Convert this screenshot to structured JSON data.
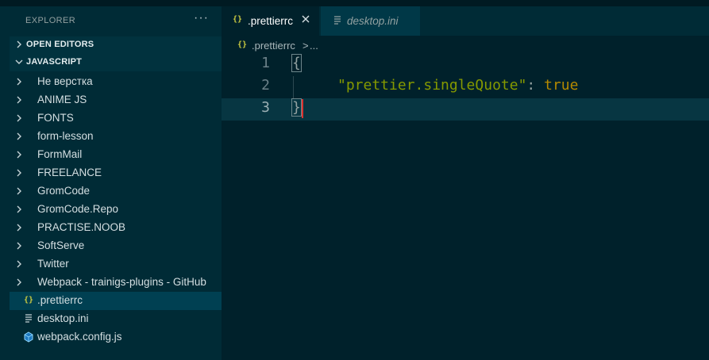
{
  "window": {
    "app": "Visual Studio Code",
    "theme": "Solarized Dark"
  },
  "explorer": {
    "title": "EXPLORER",
    "more_label": "···",
    "sections": {
      "open_editors": "OPEN EDITORS",
      "workspace": "JAVASCRIPT"
    },
    "folders": [
      "Не верстка",
      "ANIME JS",
      "FONTS",
      "form-lesson",
      "FormMail",
      "FREELANCE",
      "GromCode",
      "GromCode.Repo",
      "PRACTISE.NOOB",
      "SoftServe",
      "Twitter",
      "Webpack - trainigs-plugins - GitHub"
    ],
    "files": [
      {
        "name": ".prettierrc",
        "icon": "json-braces-icon",
        "selected": true
      },
      {
        "name": "desktop.ini",
        "icon": "text-lines-icon",
        "selected": false
      },
      {
        "name": "webpack.config.js",
        "icon": "webpack-cube-icon",
        "selected": false
      }
    ]
  },
  "tabs": [
    {
      "label": ".prettierrc",
      "icon": "json-braces-icon",
      "active": true,
      "close_icon": "close-icon"
    },
    {
      "label": "desktop.ini",
      "icon": "text-lines-icon",
      "active": false
    }
  ],
  "breadcrumb": {
    "file": ".prettierrc",
    "separator": ">",
    "more": "..."
  },
  "editor": {
    "lines": [
      {
        "number": "1",
        "text": "{"
      },
      {
        "number": "2",
        "key": "\"prettier.singleQuote\"",
        "colon": ": ",
        "value": "true"
      },
      {
        "number": "3",
        "text": "}"
      }
    ]
  },
  "icons": {
    "braces_glyph": "{}",
    "file_glyph": "≡"
  },
  "colors": {
    "editor_bg": "#00212b",
    "sidebar_bg": "#002b36",
    "string": "#859900",
    "keyword": "#b58900",
    "cursor": "#dc322f",
    "json_icon": "#cbcb41"
  }
}
